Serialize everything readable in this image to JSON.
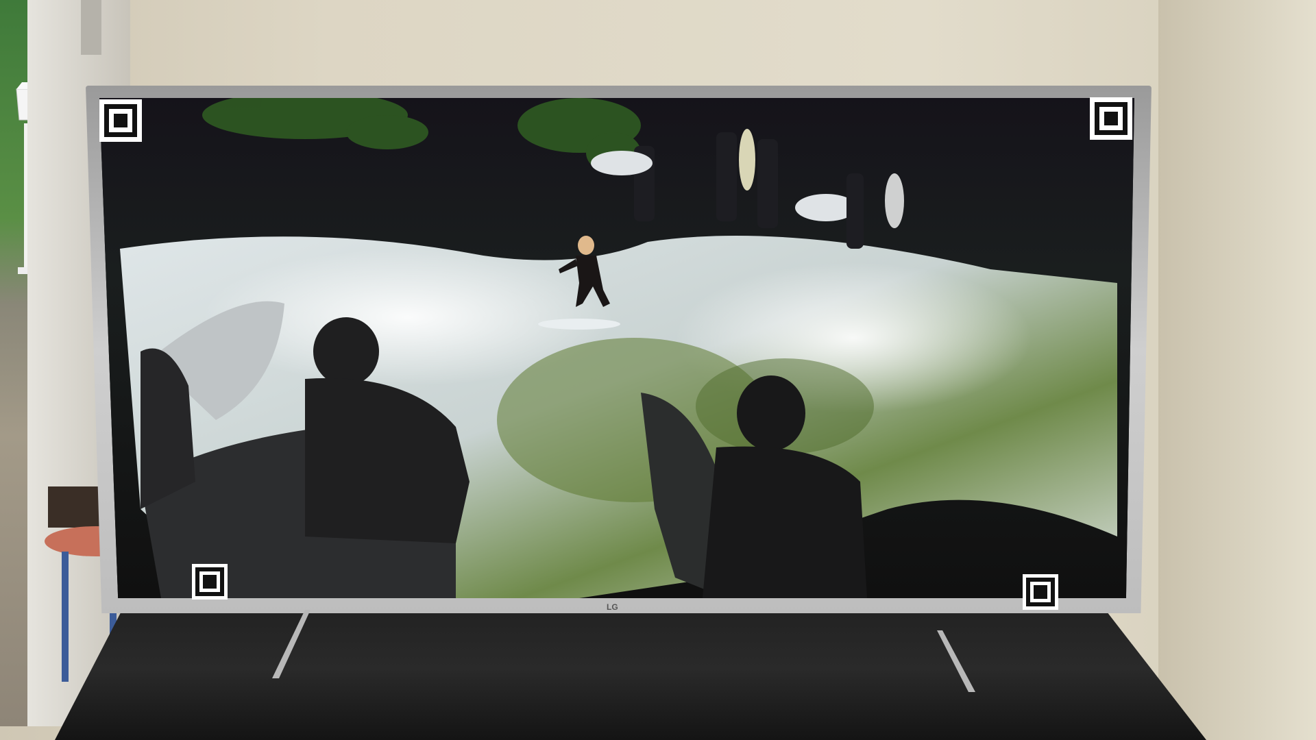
{
  "scene": {
    "description_colors": {
      "wall": "#ddd6c4",
      "cabinet": "#1c1c1c",
      "tv_frame": "#c0c0c0",
      "water_white": "#e9eef0",
      "water_green": "#4f6b2c"
    }
  },
  "tv": {
    "logo": "LG"
  },
  "markers": [
    {
      "name": "marker-top-left"
    },
    {
      "name": "marker-top-right"
    },
    {
      "name": "marker-bottom-left"
    },
    {
      "name": "marker-bottom-right"
    }
  ]
}
